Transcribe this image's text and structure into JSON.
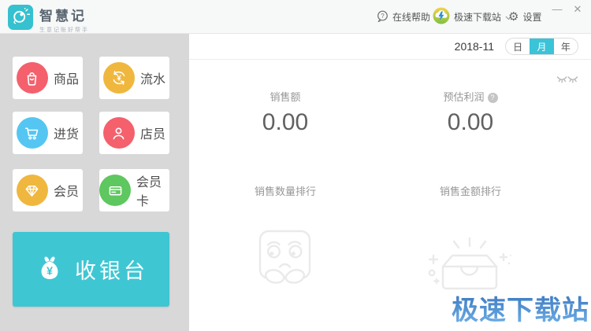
{
  "window": {
    "minimize_glyph": "—",
    "close_glyph": "✕"
  },
  "topbar": {
    "app_name": "智慧记",
    "app_tagline": "生意记账好帮手",
    "help_label": "在线帮助",
    "downloader_label": "极速下载站",
    "settings_label": "设置",
    "settings_gear_glyph": "⚙",
    "help_glyph": "?"
  },
  "sidebar": {
    "items": [
      {
        "label": "商品",
        "icon": "bag-icon",
        "color": "#f4606c"
      },
      {
        "label": "流水",
        "icon": "yen-cycle-icon",
        "color": "#f0b73e"
      },
      {
        "label": "进货",
        "icon": "cart-icon",
        "color": "#55c6f2"
      },
      {
        "label": "店员",
        "icon": "person-icon",
        "color": "#f4606c"
      },
      {
        "label": "会员",
        "icon": "diamond-icon",
        "color": "#f0b73e"
      },
      {
        "label": "会员卡",
        "icon": "card-icon",
        "color": "#5ec75f"
      }
    ],
    "checkout_label": "收银台",
    "checkout_color": "#3fc6d3",
    "yen_glyph": "¥"
  },
  "main": {
    "date": "2018-11",
    "period_tabs": [
      {
        "label": "日",
        "active": false
      },
      {
        "label": "月",
        "active": true
      },
      {
        "label": "年",
        "active": false
      }
    ],
    "stats": [
      {
        "label": "销售额",
        "value": "0.00"
      },
      {
        "label": "预估利润",
        "value": "0.00",
        "help_glyph": "?"
      }
    ],
    "rankings": [
      {
        "label": "销售数量排行",
        "empty_state": "sad-box"
      },
      {
        "label": "销售金额排行",
        "empty_state": "empty-tray"
      }
    ]
  },
  "watermark": {
    "text": "极速下载站",
    "color_top": "#3a77c0",
    "color_bottom": "#6cace4"
  },
  "colors": {
    "accent_teal": "#3fc6d3",
    "segment_active": "#3bc3d8",
    "logo_teal": "#35c1cf",
    "sidebar_bg": "#d8d8d8",
    "topbar_bg": "#f7f8f8"
  }
}
